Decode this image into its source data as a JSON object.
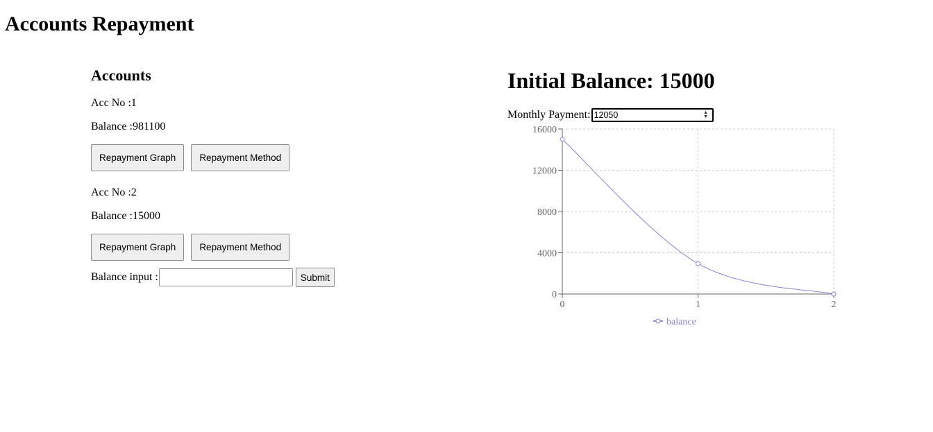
{
  "page": {
    "title": "Accounts Repayment"
  },
  "accounts": {
    "heading": "Accounts",
    "items": [
      {
        "acc_label": "Acc No :1",
        "balance_label": "Balance :981100",
        "graph_label": "Repayment Graph",
        "method_label": "Repayment Method"
      },
      {
        "acc_label": "Acc No :2",
        "balance_label": "Balance :15000",
        "graph_label": "Repayment Graph",
        "method_label": "Repayment Method"
      }
    ],
    "balance_input": {
      "label": "Balance input :",
      "value": "",
      "placeholder": ""
    },
    "submit_label": "Submit"
  },
  "graph": {
    "heading": "Initial Balance: 15000",
    "payment_label": "Monthly Payment:",
    "payment_value": "12050"
  },
  "chart_data": {
    "type": "line",
    "x": [
      0,
      1,
      2
    ],
    "series": [
      {
        "name": "balance",
        "values": [
          15000,
          2950,
          0
        ]
      }
    ],
    "xlim": [
      0,
      2
    ],
    "ylim": [
      0,
      16000
    ],
    "xticks": [
      "0",
      "1",
      "2"
    ],
    "yticks": [
      "0",
      "4000",
      "8000",
      "12000",
      "16000"
    ],
    "grid": true,
    "legend_position": "bottom",
    "line_color": "#8884d8"
  }
}
